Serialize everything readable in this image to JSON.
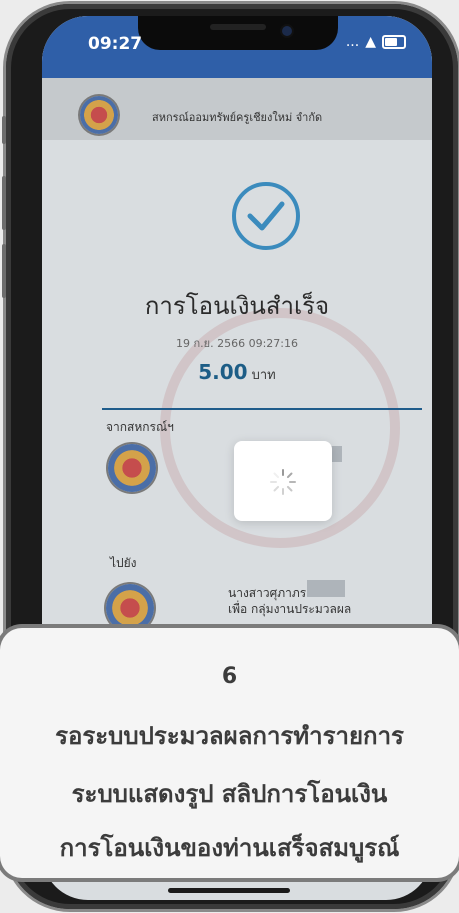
{
  "status_bar": {
    "time": "09:27",
    "signal": "...",
    "wifi": "wifi",
    "battery": "battery"
  },
  "header": {
    "coop_name": "สหกรณ์ออมทรัพย์ครูเชียงใหม่ จำกัด"
  },
  "result": {
    "title": "การโอนเงินสำเร็จ",
    "datetime": "19 ก.ย. 2566 09:27:16",
    "amount": "5.00",
    "currency": "บาท"
  },
  "from": {
    "label": "จากสหกรณ์ฯ"
  },
  "to": {
    "label": "ไปยัง",
    "name": "นางสาวศุภาภรณ์",
    "purpose": "เพื่อ กลุ่มงานประมวลผล"
  },
  "message": {
    "step": "6",
    "line1": "รอระบบประมวลผลการทำรายการ",
    "line2": "ระบบแสดงรูป สลิปการโอนเงิน",
    "line3": "การโอนเงินของท่านเสร็จสมบูรณ์"
  },
  "colors": {
    "accent": "#1d5d86",
    "check": "#3b8bbd",
    "card": "#f5f5f5"
  }
}
